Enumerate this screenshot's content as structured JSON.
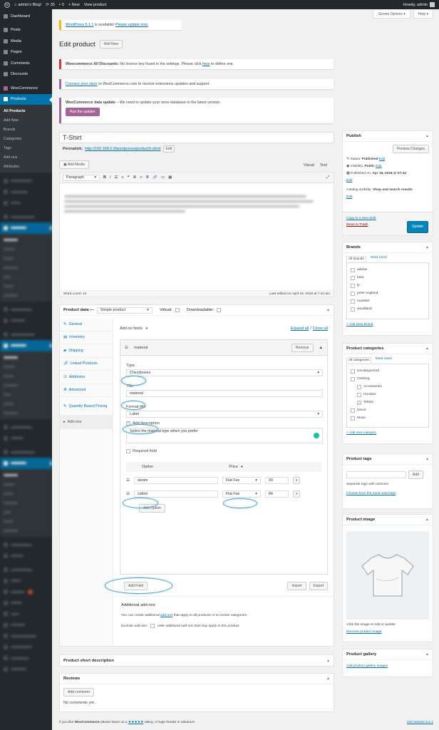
{
  "adminbar": {
    "site": "admin's Blog!",
    "updates": "35",
    "comments": "0",
    "new": "+ New",
    "view": "View product",
    "howdy": "Howdy, admin"
  },
  "sidebar": {
    "items": [
      {
        "label": "Dashboard",
        "icon": "dashboard-icon"
      },
      {
        "label": "Posts",
        "icon": "pin-icon"
      },
      {
        "label": "Media",
        "icon": "media-icon"
      },
      {
        "label": "Pages",
        "icon": "pages-icon"
      },
      {
        "label": "Comments",
        "icon": "comments-icon"
      },
      {
        "label": "Discounts",
        "icon": "discount-icon"
      },
      {
        "label": "WooCommerce",
        "icon": "woocommerce-icon"
      },
      {
        "label": "Products",
        "icon": "products-icon"
      }
    ],
    "sub": [
      "All Products",
      "Add New",
      "Brands",
      "Categories",
      "Tags",
      "Add-ons",
      "Attributes"
    ]
  },
  "screen": {
    "options": "Screen Options ▾",
    "help": "Help ▾"
  },
  "notices": {
    "wp_update_link": "WordPress 5.1.1",
    "wp_update_mid": "is available!",
    "wp_update_link2": "Please update now.",
    "discounts_bold": "Woocommerce All Discounts:",
    "discounts_text": "No licence key found in the settings. Please click",
    "discounts_here": "here",
    "discounts_end": "to define one.",
    "connect_link": "Connect your store",
    "connect_text": "to WooCommerce.com to receive extensions updates and support.",
    "data_update_bold": "WooCommerce data update",
    "data_update_text": "– We need to update your store database to the latest version.",
    "run_updater": "Run the updater"
  },
  "page": {
    "title": "Edit product",
    "add_new": "Add New"
  },
  "editor": {
    "post_title": "T-Shirt",
    "permalink_label": "Permalink:",
    "permalink_url": "http://192.168.0.9/wordpress/product/t-shirt/",
    "edit": "Edit",
    "add_media": "Add Media",
    "visual": "Visual",
    "text": "Text",
    "format": "Paragraph",
    "word_count": "Word count: 41",
    "last_edited": "Last edited on April 18, 2018 at 7:44 am"
  },
  "product_data": {
    "label": "Product data —",
    "type": "Simple product",
    "virtual": "Virtual:",
    "downloadable": "Downloadable:",
    "tabs": [
      "General",
      "Inventory",
      "Shipping",
      "Linked Products",
      "Attributes",
      "Advanced",
      "Quantity Based Pricing",
      "Add-ons"
    ],
    "addon_fields": "Add-on fields",
    "expand": "Expand all",
    "close": "Close all",
    "addon_name": "material",
    "remove": "Remove",
    "type_label": "Type",
    "type_value": "Checkboxes",
    "title_label": "Title",
    "title_value": "material",
    "format_label": "Format title",
    "format_value": "Label",
    "add_description": "Add description",
    "description": "Select the material type which you prefer",
    "required": "Required field",
    "option_header": "Option",
    "price_header": "Price",
    "options": [
      {
        "name": "danim",
        "fee": "Flat Fee",
        "price": "99"
      },
      {
        "name": "cotton",
        "fee": "Flat Fee",
        "price": "84"
      }
    ],
    "add_option": "Add Option",
    "add_field": "Add Field",
    "import": "Import",
    "export": "Export",
    "additional_title": "Additional add-ons",
    "additional_text_a": "You can create additional",
    "additional_link": "add-ons",
    "additional_text_b": "that apply to all products or to certain categories.",
    "exclude_label": "Exclude add-ons:",
    "exclude_text": "Hide additional add-ons that may apply to this product."
  },
  "short_desc": {
    "title": "Product short description"
  },
  "reviews": {
    "title": "Reviews",
    "add_comment": "Add comment",
    "none": "No comments yet."
  },
  "publish": {
    "title": "Publish",
    "preview": "Preview Changes",
    "status_label": "Status:",
    "status": "Published",
    "visibility_label": "Visibility:",
    "visibility": "Public",
    "published_on_label": "Published on:",
    "published_on": "Apr 18, 2018 @ 07:42",
    "edit": "Edit",
    "catalog_label": "Catalog visibility:",
    "catalog": "Shop and search results",
    "copy": "Copy to a new draft",
    "trash": "Move to Trash",
    "update": "Update"
  },
  "brands": {
    "title": "Brands",
    "all": "All Brands",
    "most": "Most Used",
    "items": [
      "adidas",
      "bata",
      "lp",
      "peter england",
      "roadster",
      "woodland"
    ],
    "add": "+ Add New Brand"
  },
  "categories": {
    "title": "Product categories",
    "all": "All categories",
    "most": "Most Used",
    "items": [
      {
        "name": "Uncategorized",
        "checked": false,
        "indent": 0
      },
      {
        "name": "Clothing",
        "checked": false,
        "indent": 0
      },
      {
        "name": "Accessories",
        "checked": false,
        "indent": 1
      },
      {
        "name": "Hoodies",
        "checked": false,
        "indent": 1
      },
      {
        "name": "Tshirts",
        "checked": true,
        "indent": 1
      },
      {
        "name": "Decor",
        "checked": false,
        "indent": 0
      },
      {
        "name": "Music",
        "checked": false,
        "indent": 0
      }
    ],
    "add": "+ Add new category"
  },
  "tags": {
    "title": "Product tags",
    "add": "Add",
    "hint": "Separate tags with commas",
    "most": "Choose from the most used tags"
  },
  "image": {
    "title": "Product image",
    "hint": "Click the image to edit or update",
    "remove": "Remove product image"
  },
  "gallery": {
    "title": "Product gallery",
    "add": "Add product gallery images"
  },
  "footer": {
    "text_a": "If you like",
    "woo": "WooCommerce",
    "text_b": "please leave us a",
    "stars": "★★★★★",
    "text_c": "rating. A huge thanks in advance!",
    "version": "Get Version 5.1.1"
  },
  "colors": {
    "adminbar": "#23282d",
    "sidebar_active": "#0073aa",
    "woo_purple": "#a46497",
    "link": "#0073aa",
    "highlight_ellipse": "#4fa0d2"
  }
}
